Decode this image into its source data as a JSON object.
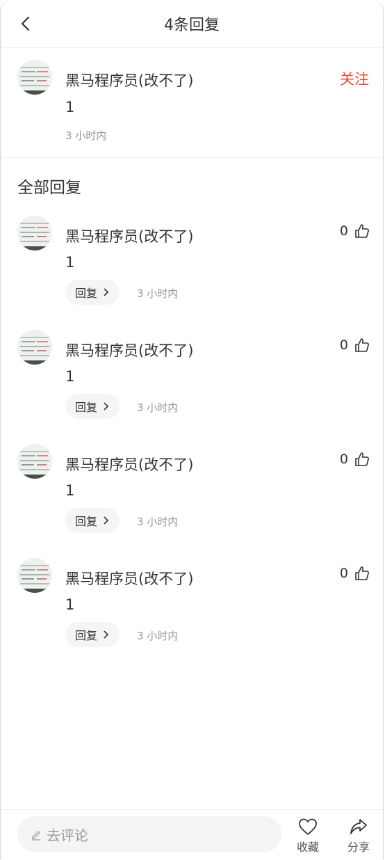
{
  "header": {
    "title": "4条回复"
  },
  "top_comment": {
    "author": "黑马程序员(改不了)",
    "content": "1",
    "time": "3 小时内",
    "follow_label": "关注"
  },
  "section_title": "全部回复",
  "replies": [
    {
      "author": "黑马程序员(改不了)",
      "content": "1",
      "likes": "0",
      "reply_label": "回复",
      "time": "3 小时内"
    },
    {
      "author": "黑马程序员(改不了)",
      "content": "1",
      "likes": "0",
      "reply_label": "回复",
      "time": "3 小时内"
    },
    {
      "author": "黑马程序员(改不了)",
      "content": "1",
      "likes": "0",
      "reply_label": "回复",
      "time": "3 小时内"
    },
    {
      "author": "黑马程序员(改不了)",
      "content": "1",
      "likes": "0",
      "reply_label": "回复",
      "time": "3 小时内"
    }
  ],
  "bottom": {
    "comment_placeholder": "去评论",
    "favorite_label": "收藏",
    "share_label": "分享"
  },
  "colors": {
    "accent": "#ee4b3a",
    "muted": "#999999"
  },
  "icons": {
    "back": "chevron-left-icon",
    "like": "thumbs-up-icon",
    "favorite": "heart-icon",
    "share": "share-icon",
    "pen": "pen-icon"
  }
}
